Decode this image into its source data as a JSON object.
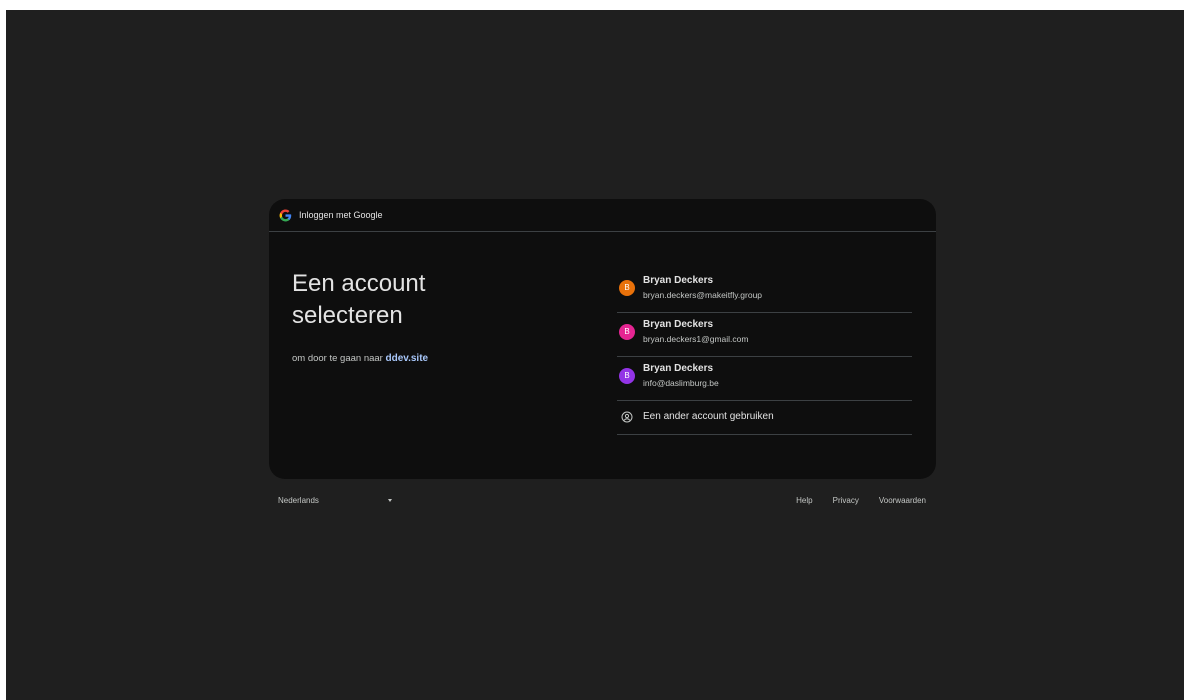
{
  "header": {
    "title": "Inloggen met Google"
  },
  "main": {
    "headline": "Een account selecteren",
    "subtitle_prefix": "om door te gaan naar",
    "site": "ddev.site"
  },
  "accounts": [
    {
      "initial": "B",
      "name": "Bryan Deckers",
      "email": "bryan.deckers@makeitfly.group",
      "color": "#e8710a"
    },
    {
      "initial": "B",
      "name": "Bryan Deckers",
      "email": "bryan.deckers1@gmail.com",
      "color": "#e52592"
    },
    {
      "initial": "B",
      "name": "Bryan Deckers",
      "email": "info@daslimburg.be",
      "color": "#9334e6"
    }
  ],
  "other_account": {
    "label": "Een ander account gebruiken",
    "icon": "account-circle-icon"
  },
  "footer": {
    "language": "Nederlands",
    "links": [
      "Help",
      "Privacy",
      "Voorwaarden"
    ]
  },
  "colors": {
    "page_background": "#1f1f1f",
    "card_background": "#0e0e0e",
    "divider": "#3c4043",
    "link_accent": "#a8c7fa"
  }
}
